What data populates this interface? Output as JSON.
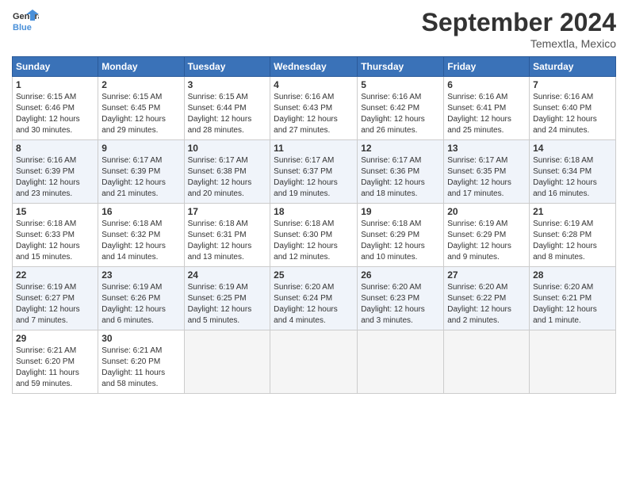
{
  "logo": {
    "line1": "General",
    "line2": "Blue"
  },
  "title": "September 2024",
  "location": "Temextla, Mexico",
  "days_header": [
    "Sunday",
    "Monday",
    "Tuesday",
    "Wednesday",
    "Thursday",
    "Friday",
    "Saturday"
  ],
  "weeks": [
    [
      {
        "day": "1",
        "info": "Sunrise: 6:15 AM\nSunset: 6:46 PM\nDaylight: 12 hours\nand 30 minutes."
      },
      {
        "day": "2",
        "info": "Sunrise: 6:15 AM\nSunset: 6:45 PM\nDaylight: 12 hours\nand 29 minutes."
      },
      {
        "day": "3",
        "info": "Sunrise: 6:15 AM\nSunset: 6:44 PM\nDaylight: 12 hours\nand 28 minutes."
      },
      {
        "day": "4",
        "info": "Sunrise: 6:16 AM\nSunset: 6:43 PM\nDaylight: 12 hours\nand 27 minutes."
      },
      {
        "day": "5",
        "info": "Sunrise: 6:16 AM\nSunset: 6:42 PM\nDaylight: 12 hours\nand 26 minutes."
      },
      {
        "day": "6",
        "info": "Sunrise: 6:16 AM\nSunset: 6:41 PM\nDaylight: 12 hours\nand 25 minutes."
      },
      {
        "day": "7",
        "info": "Sunrise: 6:16 AM\nSunset: 6:40 PM\nDaylight: 12 hours\nand 24 minutes."
      }
    ],
    [
      {
        "day": "8",
        "info": "Sunrise: 6:16 AM\nSunset: 6:39 PM\nDaylight: 12 hours\nand 23 minutes."
      },
      {
        "day": "9",
        "info": "Sunrise: 6:17 AM\nSunset: 6:39 PM\nDaylight: 12 hours\nand 21 minutes."
      },
      {
        "day": "10",
        "info": "Sunrise: 6:17 AM\nSunset: 6:38 PM\nDaylight: 12 hours\nand 20 minutes."
      },
      {
        "day": "11",
        "info": "Sunrise: 6:17 AM\nSunset: 6:37 PM\nDaylight: 12 hours\nand 19 minutes."
      },
      {
        "day": "12",
        "info": "Sunrise: 6:17 AM\nSunset: 6:36 PM\nDaylight: 12 hours\nand 18 minutes."
      },
      {
        "day": "13",
        "info": "Sunrise: 6:17 AM\nSunset: 6:35 PM\nDaylight: 12 hours\nand 17 minutes."
      },
      {
        "day": "14",
        "info": "Sunrise: 6:18 AM\nSunset: 6:34 PM\nDaylight: 12 hours\nand 16 minutes."
      }
    ],
    [
      {
        "day": "15",
        "info": "Sunrise: 6:18 AM\nSunset: 6:33 PM\nDaylight: 12 hours\nand 15 minutes."
      },
      {
        "day": "16",
        "info": "Sunrise: 6:18 AM\nSunset: 6:32 PM\nDaylight: 12 hours\nand 14 minutes."
      },
      {
        "day": "17",
        "info": "Sunrise: 6:18 AM\nSunset: 6:31 PM\nDaylight: 12 hours\nand 13 minutes."
      },
      {
        "day": "18",
        "info": "Sunrise: 6:18 AM\nSunset: 6:30 PM\nDaylight: 12 hours\nand 12 minutes."
      },
      {
        "day": "19",
        "info": "Sunrise: 6:18 AM\nSunset: 6:29 PM\nDaylight: 12 hours\nand 10 minutes."
      },
      {
        "day": "20",
        "info": "Sunrise: 6:19 AM\nSunset: 6:29 PM\nDaylight: 12 hours\nand 9 minutes."
      },
      {
        "day": "21",
        "info": "Sunrise: 6:19 AM\nSunset: 6:28 PM\nDaylight: 12 hours\nand 8 minutes."
      }
    ],
    [
      {
        "day": "22",
        "info": "Sunrise: 6:19 AM\nSunset: 6:27 PM\nDaylight: 12 hours\nand 7 minutes."
      },
      {
        "day": "23",
        "info": "Sunrise: 6:19 AM\nSunset: 6:26 PM\nDaylight: 12 hours\nand 6 minutes."
      },
      {
        "day": "24",
        "info": "Sunrise: 6:19 AM\nSunset: 6:25 PM\nDaylight: 12 hours\nand 5 minutes."
      },
      {
        "day": "25",
        "info": "Sunrise: 6:20 AM\nSunset: 6:24 PM\nDaylight: 12 hours\nand 4 minutes."
      },
      {
        "day": "26",
        "info": "Sunrise: 6:20 AM\nSunset: 6:23 PM\nDaylight: 12 hours\nand 3 minutes."
      },
      {
        "day": "27",
        "info": "Sunrise: 6:20 AM\nSunset: 6:22 PM\nDaylight: 12 hours\nand 2 minutes."
      },
      {
        "day": "28",
        "info": "Sunrise: 6:20 AM\nSunset: 6:21 PM\nDaylight: 12 hours\nand 1 minute."
      }
    ],
    [
      {
        "day": "29",
        "info": "Sunrise: 6:21 AM\nSunset: 6:20 PM\nDaylight: 11 hours\nand 59 minutes."
      },
      {
        "day": "30",
        "info": "Sunrise: 6:21 AM\nSunset: 6:20 PM\nDaylight: 11 hours\nand 58 minutes."
      },
      {
        "day": "",
        "info": ""
      },
      {
        "day": "",
        "info": ""
      },
      {
        "day": "",
        "info": ""
      },
      {
        "day": "",
        "info": ""
      },
      {
        "day": "",
        "info": ""
      }
    ]
  ]
}
